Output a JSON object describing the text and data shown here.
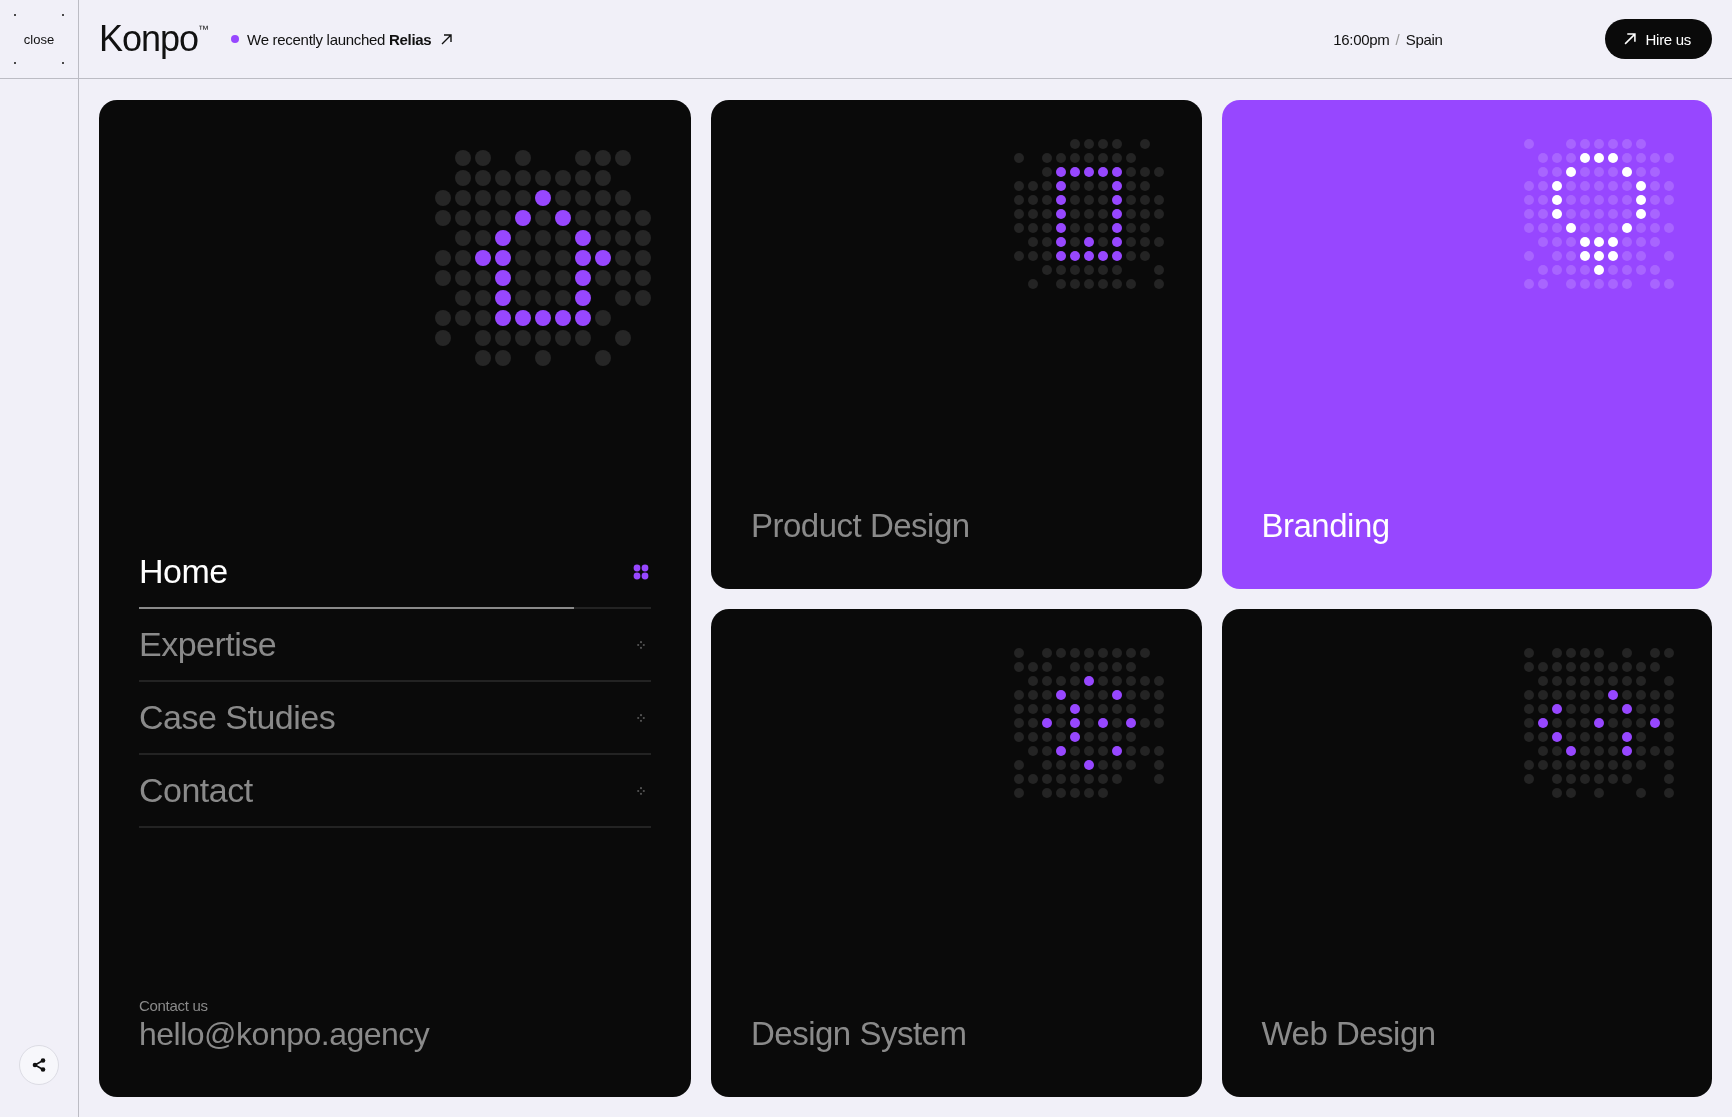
{
  "rail": {
    "close": "close"
  },
  "header": {
    "logo": "Konpo$^{™}$",
    "announcement": "We recently launched **Relias**",
    "time": "16:00pm",
    "separator": "/",
    "location": "Spain",
    "cta": "Hire us"
  },
  "menu": {
    "items": [
      {
        "label": "Home",
        "selected": true,
        "level": 0.85
      },
      {
        "label": "Expertise",
        "selected": false
      },
      {
        "label": "Case Studies",
        "selected": false
      },
      {
        "label": "Contact",
        "selected": false
      }
    ],
    "contact_label": "Contact us",
    "email": "hello@konpo.agency"
  },
  "cards": [
    {
      "title": "Product Design",
      "kind": "dark"
    },
    {
      "title": "Branding",
      "kind": "accent"
    },
    {
      "title": "Design System",
      "kind": "dark"
    },
    {
      "title": "Web Design",
      "kind": "dark"
    }
  ]
}
